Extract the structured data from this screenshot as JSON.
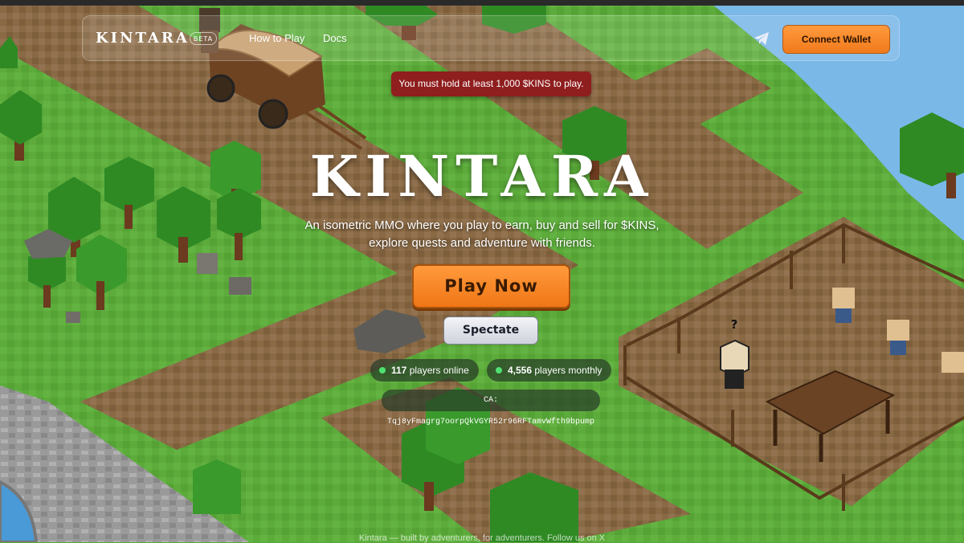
{
  "nav": {
    "logo": "KINTARA",
    "badge": "BETA",
    "links": [
      "How to Play",
      "Docs"
    ],
    "connect_label": "Connect Wallet"
  },
  "alert": {
    "text": "You must hold at least 1,000 $KINS to play."
  },
  "hero": {
    "title": "KINTARA",
    "tagline_line1": "An isometric MMO where you play to earn, buy and sell for $KINS,",
    "tagline_line2": "explore quests and adventure with friends.",
    "play_label": "Play Now",
    "spectate_label": "Spectate"
  },
  "stats": {
    "online_count": "117",
    "online_label": "players online",
    "monthly_count": "4,556",
    "monthly_label": "players monthly"
  },
  "contract": {
    "text": "CA: Tqj8yFmagrg7oorpQkVGYR52r96RFTamvWfth9bpump"
  },
  "footer": {
    "text": "Kintara — built by adventurers, for adventurers. Follow us on X"
  },
  "npc": {
    "marker": "?"
  },
  "colors": {
    "grass": "#5aa83a",
    "dirt": "#8a6a45",
    "water": "#7ab8e8",
    "accent": "#f0821f",
    "alert": "#8f1e1e"
  }
}
